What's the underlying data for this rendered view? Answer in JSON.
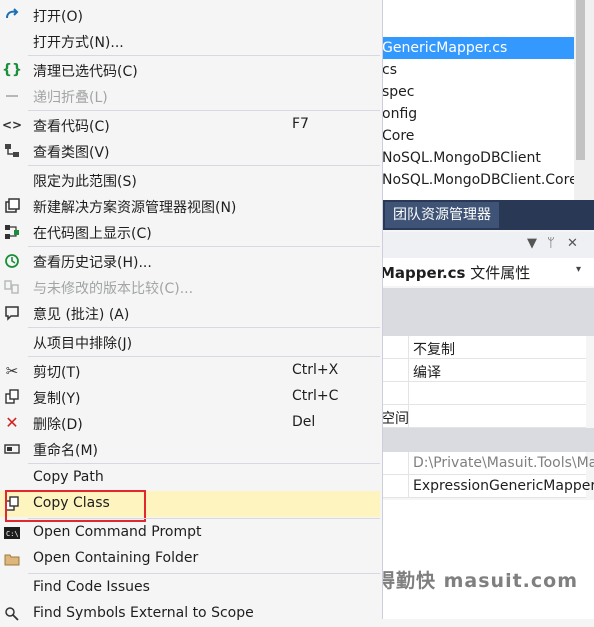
{
  "solution_explorer": {
    "rows": [
      {
        "text": "",
        "selected": false
      },
      {
        "text": "GenericMapper.cs",
        "selected": true
      },
      {
        "text": "cs",
        "selected": false
      },
      {
        "text": "spec",
        "selected": false
      },
      {
        "text": "onfig",
        "selected": false
      },
      {
        "text": "Core",
        "selected": false
      },
      {
        "text": "NoSQL.MongoDBClient",
        "selected": false
      },
      {
        "text": "NoSQL.MongoDBClient.Core",
        "selected": false
      }
    ],
    "tab_label": "团队资源管理器"
  },
  "properties": {
    "header_buttons": [
      "▼",
      "ᛘ",
      "✕"
    ],
    "title_bold": "Mapper.cs",
    "title_rest": " 文件属性",
    "dropdown": "▾",
    "values": {
      "copy": "不复制",
      "build": "编译",
      "namespace_label": "空间",
      "path": "D:\\Private\\Masuit.Tools\\Ma",
      "filename": "ExpressionGenericMapper."
    }
  },
  "watermark": "懒得勤快 masuit.com",
  "menu": {
    "items": [
      {
        "label": "打开(O)",
        "shortcut": "",
        "icon": "open-icon",
        "disabled": false
      },
      {
        "label": "打开方式(N)...",
        "shortcut": "",
        "icon": "",
        "disabled": false
      },
      {
        "label": "清理已选代码(C)",
        "shortcut": "",
        "icon": "cleanup-braces-icon",
        "disabled": false
      },
      {
        "label": "递归折叠(L)",
        "shortcut": "",
        "icon": "collapse-icon",
        "disabled": true
      },
      {
        "label": "查看代码(C)",
        "shortcut": "F7",
        "icon": "view-code-icon",
        "disabled": false
      },
      {
        "label": "查看类图(V)",
        "shortcut": "",
        "icon": "class-diagram-icon",
        "disabled": false
      },
      {
        "label": "限定为此范围(S)",
        "shortcut": "",
        "icon": "",
        "disabled": false
      },
      {
        "label": "新建解决方案资源管理器视图(N)",
        "shortcut": "",
        "icon": "new-view-icon",
        "disabled": false
      },
      {
        "label": "在代码图上显示(C)",
        "shortcut": "",
        "icon": "code-map-icon",
        "disabled": false
      },
      {
        "label": "查看历史记录(H)...",
        "shortcut": "",
        "icon": "history-icon",
        "disabled": false
      },
      {
        "label": "与未修改的版本比较(C)...",
        "shortcut": "",
        "icon": "compare-icon",
        "disabled": true
      },
      {
        "label": "意见 (批注) (A)",
        "shortcut": "",
        "icon": "comment-icon",
        "disabled": false
      },
      {
        "label": "从项目中排除(J)",
        "shortcut": "",
        "icon": "",
        "disabled": false
      },
      {
        "label": "剪切(T)",
        "shortcut": "Ctrl+X",
        "icon": "cut-icon",
        "disabled": false
      },
      {
        "label": "复制(Y)",
        "shortcut": "Ctrl+C",
        "icon": "copy-icon",
        "disabled": false
      },
      {
        "label": "删除(D)",
        "shortcut": "Del",
        "icon": "delete-icon",
        "disabled": false
      },
      {
        "label": "重命名(M)",
        "shortcut": "",
        "icon": "rename-icon",
        "disabled": false
      },
      {
        "label": "Copy Path",
        "shortcut": "",
        "icon": "",
        "disabled": false
      },
      {
        "label": "Copy Class",
        "shortcut": "",
        "icon": "copy-class-icon",
        "disabled": false
      },
      {
        "label": "Open Command Prompt",
        "shortcut": "",
        "icon": "command-prompt-icon",
        "disabled": false
      },
      {
        "label": "Open Containing Folder",
        "shortcut": "",
        "icon": "folder-icon",
        "disabled": false
      },
      {
        "label": "Find Code Issues",
        "shortcut": "",
        "icon": "",
        "disabled": false
      },
      {
        "label": "Find Symbols External to Scope",
        "shortcut": "",
        "icon": "find-symbols-icon",
        "disabled": false
      }
    ]
  },
  "colors": {
    "selection": "#3399ff",
    "highlight": "#fdf4bf",
    "callout_border": "#e0282e",
    "tab_bar": "#293955"
  }
}
